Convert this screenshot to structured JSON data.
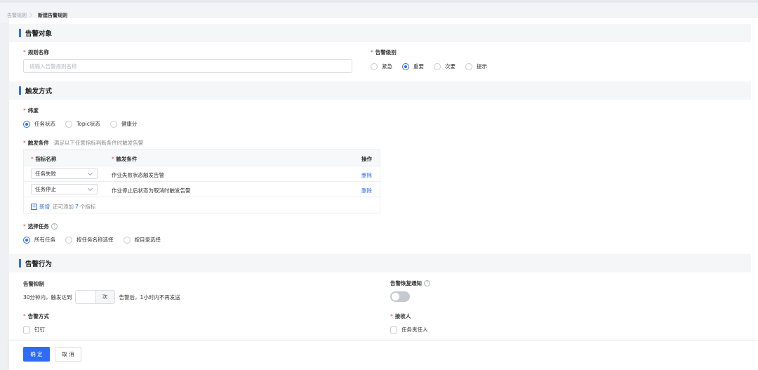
{
  "breadcrumb": {
    "parent": "告警规则",
    "separator": "〉",
    "current": "新建告警规则"
  },
  "sections": {
    "target": "告警对象",
    "trigger": "触发方式",
    "action": "告警行为"
  },
  "rule_name": {
    "label": "规则名称",
    "placeholder": "请输入告警规则名称",
    "required_mark": "*"
  },
  "alert_level": {
    "label": "告警级别",
    "options": [
      "紧急",
      "重要",
      "次要",
      "提示"
    ],
    "selected": "重要"
  },
  "dimension": {
    "label": "纬度",
    "options": [
      "任务状态",
      "Topic状态",
      "健康分"
    ],
    "selected": "任务状态"
  },
  "trigger_condition": {
    "label": "触发条件",
    "hint": "满足以下任意指标判断条件时触发告警",
    "columns": {
      "metric": "指标名称",
      "condition": "触发条件",
      "operation": "操作"
    },
    "rows": [
      {
        "metric": "任务失败",
        "condition": "作业失败状态触发告警",
        "action": "删除"
      },
      {
        "metric": "任务停止",
        "condition": "作业停止后状态为取消时触发告警",
        "action": "删除"
      }
    ],
    "add_label": "新增",
    "add_hint_prefix": "还可添加",
    "add_count": "7",
    "add_hint_suffix": "个指标"
  },
  "select_task": {
    "label": "选择任务",
    "help": "?",
    "options": [
      "所有任务",
      "按任务名称选择",
      "按目录选择"
    ],
    "selected": "所有任务"
  },
  "suppress": {
    "label": "告警抑制",
    "prefix": "30分钟内，触发达到",
    "value": "",
    "unit": "次",
    "suffix": "告警后，1小时内不再发送"
  },
  "recovery_notice": {
    "label": "告警恢复通知",
    "help": "?",
    "enabled": false
  },
  "alert_method": {
    "label": "告警方式",
    "options": [
      "钉钉"
    ]
  },
  "receivers": {
    "label": "接收人",
    "options": [
      "任务责任人"
    ]
  },
  "footer": {
    "confirm": "确 定",
    "cancel": "取 消"
  },
  "colors": {
    "accent": "#2f6bf5",
    "required": "#f04545"
  }
}
